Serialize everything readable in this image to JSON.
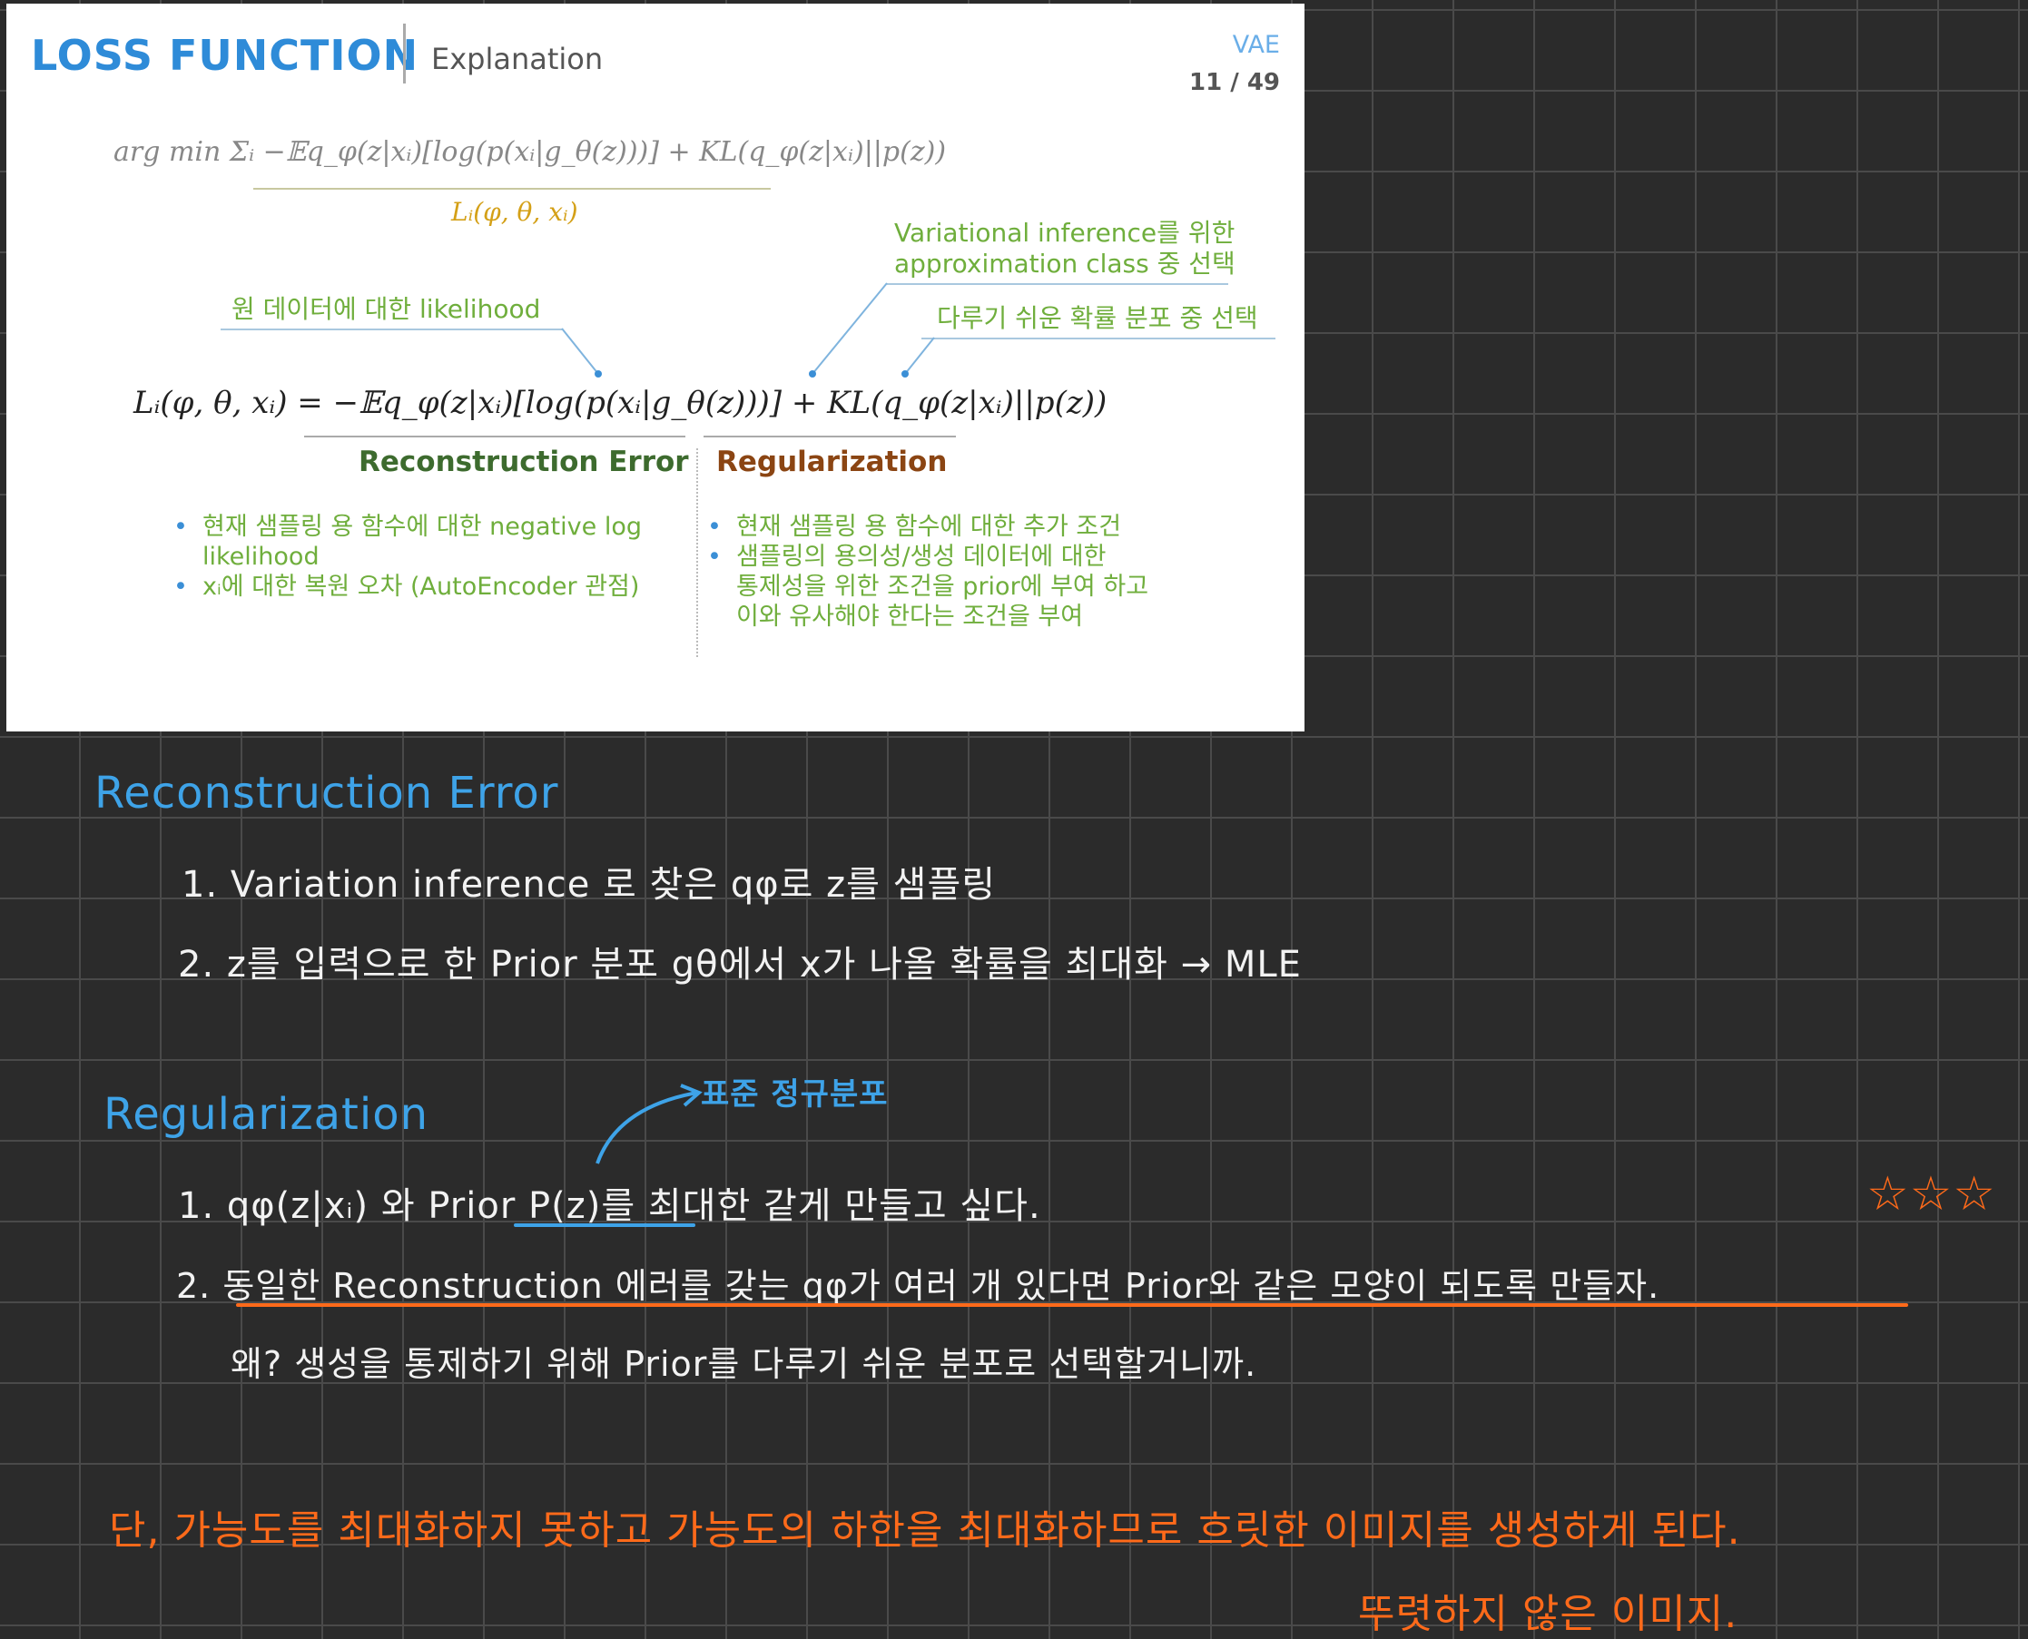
{
  "slide": {
    "title": "LOSS FUNCTION",
    "subtitle": "Explanation",
    "brand": "VAE",
    "page": "11 / 49",
    "formula_top": "arg min Σᵢ −𝔼q_φ(z|xᵢ)[log(p(xᵢ|g_θ(z)))] + KL(q_φ(z|xᵢ)||p(z))",
    "formula_top_sub": "Lᵢ(φ, θ, xᵢ)",
    "note_likelihood": "원 데이터에 대한 likelihood",
    "note_variational_1": "Variational inference를 위한",
    "note_variational_2": "approximation class 중 선택",
    "note_easy_dist": "다루기 쉬운 확률 분포 중 선택",
    "formula_main": "Lᵢ(φ, θ, xᵢ) = −𝔼q_φ(z|xᵢ)[log(p(xᵢ|g_θ(z)))] + KL(q_φ(z|xᵢ)||p(z))",
    "recon_heading": "Reconstruction Error",
    "reg_heading": "Regularization",
    "recon_bullets": [
      "현재 샘플링 용 함수에 대한 negative log",
      "likelihood",
      "xᵢ에 대한 복원 오차 (AutoEncoder 관점)"
    ],
    "reg_bullets": [
      "현재 샘플링 용 함수에 대한 추가 조건",
      "샘플링의 용의성/생성 데이터에 대한",
      "통제성을 위한 조건을 prior에 부여 하고",
      "이와 유사해야 한다는 조건을 부여"
    ],
    "colors": {
      "title": "#2e8bd8",
      "recon": "#3d6b2e",
      "reg": "#8b4513",
      "notes": "#6fae3c",
      "sub": "#d4a017"
    }
  },
  "notes": {
    "recon_title": "Reconstruction Error",
    "recon_1": "1. Variation inference 로 찾은 qφ로 z를 샘플링",
    "recon_2": "2. z를 입력으로 한 Prior 분포 gθ에서 x가 나올 확률을 최대화 → MLE",
    "annotation": "표준 정규분포",
    "reg_title": "Regularization",
    "reg_1": "1. qφ(z|xᵢ) 와 Prior P(z)를 최대한 같게 만들고 싶다.",
    "stars": "☆☆☆",
    "reg_2": "2. 동일한 Reconstruction 에러를 갖는 qφ가 여러 개 있다면 Prior와 같은 모양이 되도록 만들자.",
    "reg_why": "왜? 생성을 통제하기 위해 Prior를 다루기 쉬운 분포로 선택할거니까.",
    "conclusion": "단, 가능도를 최대화하지 못하고 가능도의 하한을 최대화하므로 흐릿한 이미지를 생성하게 된다.",
    "conclusion_2": "뚜렷하지 않은 이미지."
  }
}
